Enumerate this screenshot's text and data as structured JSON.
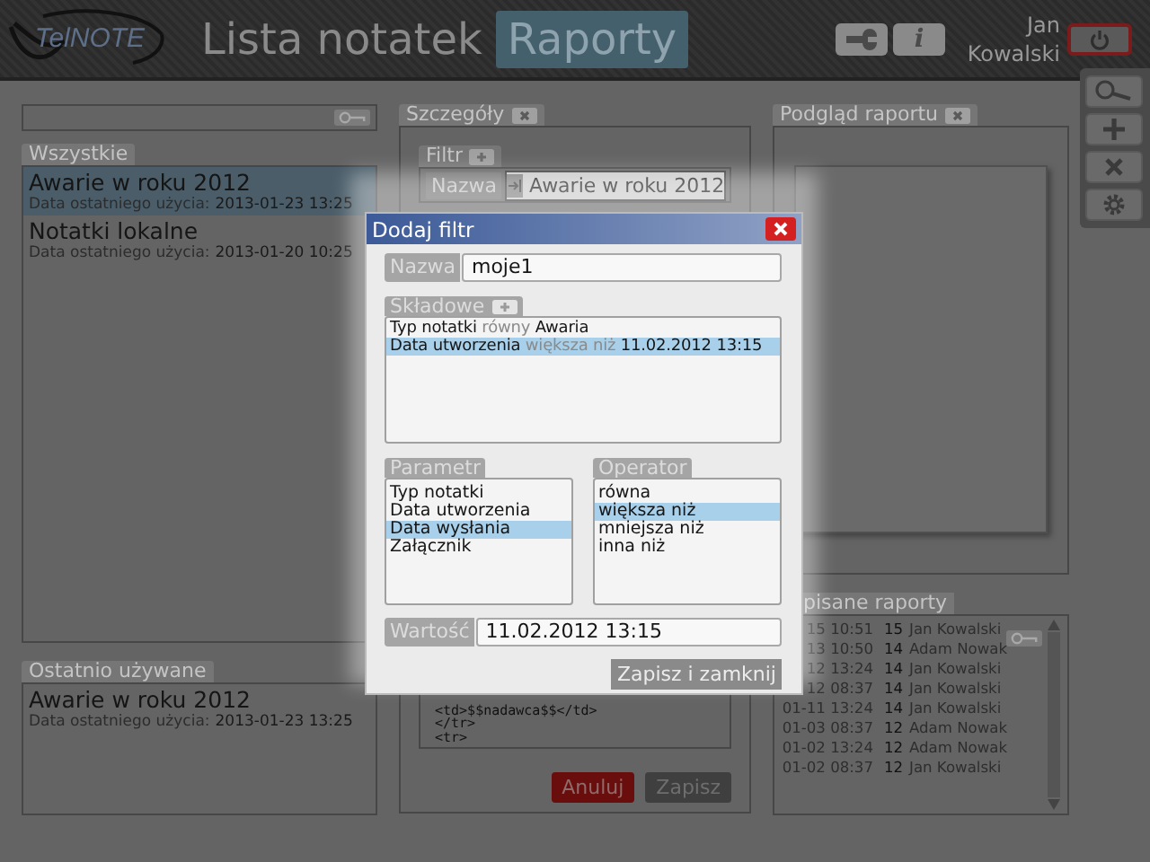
{
  "header": {
    "logo": "TelNOTE",
    "tabs": [
      {
        "label": "Lista notatek",
        "selected": false
      },
      {
        "label": "Raporty",
        "selected": true
      }
    ],
    "buttons": [
      {
        "kind": "settings"
      },
      {
        "kind": "info",
        "label": "i"
      }
    ],
    "user": "Jan Kowalski"
  },
  "all_notes": {
    "title": "Wszystkie",
    "items": [
      {
        "name": "Awarie w roku 2012",
        "meta_label": "Data ostatniego użycia:",
        "meta_value": "2013-01-23 13:25",
        "selected": true
      },
      {
        "name": "Notatki lokalne",
        "meta_label": "Data ostatniego użycia:",
        "meta_value": "2013-01-20 10:25",
        "selected": false
      }
    ]
  },
  "recent": {
    "title": "Ostatnio używane",
    "items": [
      {
        "name": "Awarie w roku 2012",
        "meta_label": "Data ostatniego użycia:",
        "meta_value": "2013-01-23 13:25",
        "selected": false
      }
    ]
  },
  "details": {
    "title": "Szczegóły",
    "filter_title": "Filtr",
    "name_label": "Nazwa",
    "name_value": "Awarie w roku 2012",
    "code_lines": [
      "<td>$$nadawca$$</td>",
      "</tr>",
      "<tr>"
    ],
    "buttons": [
      {
        "label": "Anuluj",
        "kind": "cancel"
      },
      {
        "label": "Zapisz",
        "kind": "save"
      }
    ]
  },
  "preview": {
    "title": "Podgląd raportu"
  },
  "saved_reports": {
    "title": "pisane raporty",
    "rows": [
      {
        "date": "15 10:51",
        "number": "15",
        "author": "Jan Kowalski"
      },
      {
        "date": "13 10:50",
        "number": "14",
        "author": "Adam Nowak"
      },
      {
        "date": "12 13:24",
        "number": "14",
        "author": "Jan Kowalski"
      },
      {
        "date": "12 08:37",
        "number": "14",
        "author": "Jan Kowalski"
      },
      {
        "date": "01-11 13:24",
        "number": "14",
        "author": "Jan Kowalski"
      },
      {
        "date": "01-03 08:37",
        "number": "12",
        "author": "Adam Nowak"
      },
      {
        "date": "01-02 13:24",
        "number": "12",
        "author": "Adam Nowak"
      },
      {
        "date": "01-02 08:37",
        "number": "12",
        "author": "Jan Kowalski"
      }
    ]
  },
  "toolbar": [
    {
      "kind": "search"
    },
    {
      "kind": "add"
    },
    {
      "kind": "delete"
    },
    {
      "kind": "settings"
    }
  ],
  "dialog": {
    "title": "Dodaj filtr",
    "name_label": "Nazwa",
    "name_value": "moje1",
    "components": {
      "title": "Składowe",
      "items": [
        {
          "parameter": "Typ notatki",
          "operator": "równy",
          "value": "Awaria",
          "selected": false
        },
        {
          "parameter": "Data utworzenia",
          "operator": "większa niż",
          "value": "11.02.2012 13:15",
          "selected": true
        }
      ]
    },
    "parameters": {
      "title": "Parametr",
      "items": [
        {
          "label": "Typ notatki",
          "selected": false
        },
        {
          "label": "Data utworzenia",
          "selected": false
        },
        {
          "label": "Data wysłania",
          "selected": true
        },
        {
          "label": "Załącznik",
          "selected": false
        }
      ]
    },
    "operators": {
      "title": "Operator",
      "items": [
        {
          "label": "równa",
          "selected": false
        },
        {
          "label": "większa niż",
          "selected": true
        },
        {
          "label": "mniejsza niż",
          "selected": false
        },
        {
          "label": "inna niż",
          "selected": false
        }
      ]
    },
    "value_label": "Wartość",
    "value": "11.02.2012 13:15",
    "submit": "Zapisz i zamknij"
  }
}
